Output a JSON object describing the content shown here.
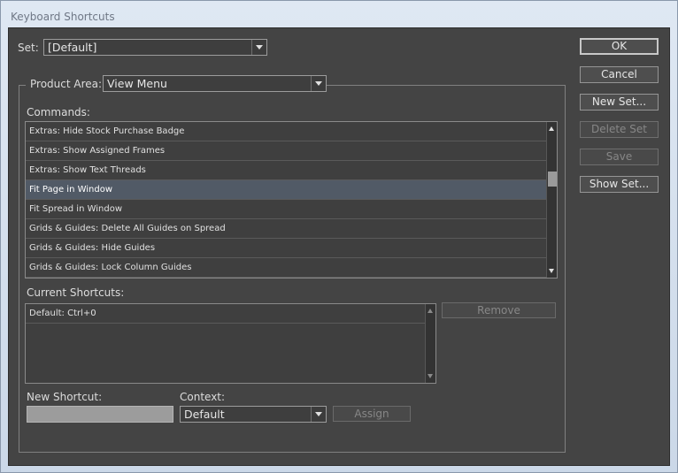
{
  "window": {
    "title": "Keyboard Shortcuts"
  },
  "set": {
    "label": "Set:",
    "value": "[Default]"
  },
  "product_area": {
    "label": "Product Area:",
    "value": "View Menu"
  },
  "commands": {
    "label": "Commands:",
    "items": [
      "Extras: Hide Stock Purchase Badge",
      "Extras: Show Assigned Frames",
      "Extras: Show Text Threads",
      "Fit Page in Window",
      "Fit Spread in Window",
      "Grids & Guides: Delete All Guides on Spread",
      "Grids & Guides: Hide Guides",
      "Grids & Guides: Lock Column Guides"
    ],
    "selected_index": 3
  },
  "current_shortcuts": {
    "label": "Current Shortcuts:",
    "items": [
      "Default: Ctrl+0"
    ]
  },
  "buttons": {
    "ok": "OK",
    "cancel": "Cancel",
    "new_set": "New Set...",
    "delete_set": "Delete Set",
    "save": "Save",
    "show_set": "Show Set...",
    "remove": "Remove",
    "assign": "Assign"
  },
  "new_shortcut": {
    "label": "New Shortcut:",
    "value": ""
  },
  "context": {
    "label": "Context:",
    "value": "Default"
  }
}
